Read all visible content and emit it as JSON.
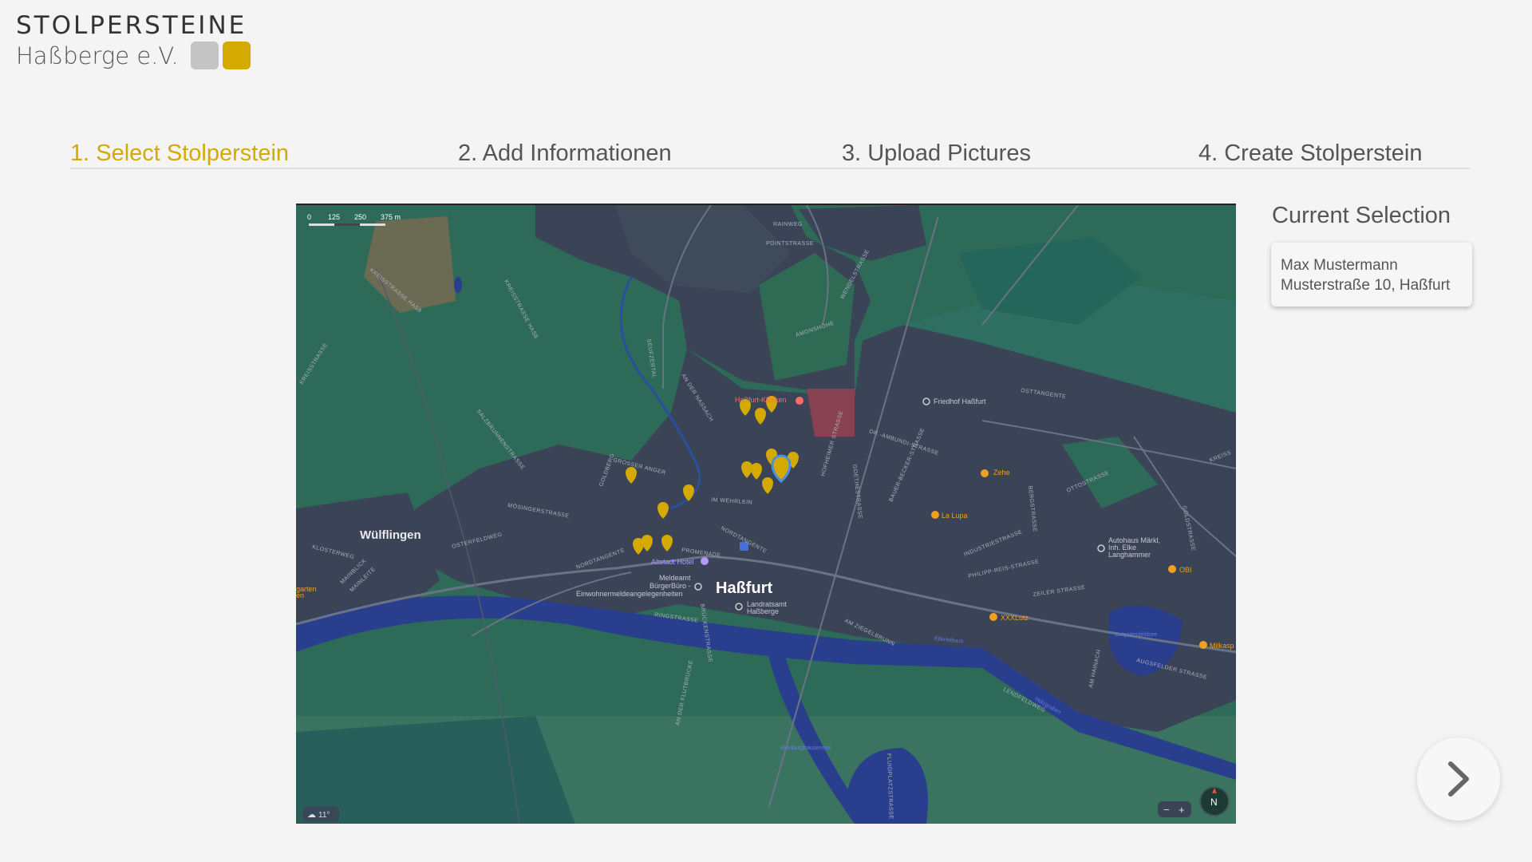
{
  "logo": {
    "title": "STOLPERSTEINE",
    "subtitle": "Haßberge e.V.",
    "colors": [
      "#c4c4c4",
      "#d4aa00"
    ]
  },
  "steps": [
    {
      "label": "1. Select Stolperstein",
      "active": true
    },
    {
      "label": "2. Add Informationen",
      "active": false
    },
    {
      "label": "3. Upload Pictures",
      "active": false
    },
    {
      "label": "4. Create Stolperstein",
      "active": false
    }
  ],
  "accent_color": "#d4aa00",
  "map": {
    "scale_labels": [
      "0",
      "125",
      "250",
      "375 m"
    ],
    "weather": "11°",
    "compass": "N",
    "zoom_out": "−",
    "zoom_in": "+",
    "places": {
      "hassfurt": "Haßfurt",
      "wuelflingen": "Wülflingen",
      "kliniken": "Haßfurt-Kliniken",
      "friedhof": "Friedhof Haßfurt",
      "zehe": "Zehe",
      "la_lupa": "La Lupa",
      "altstadt_hotel": "Altstadt Hotel",
      "meldeamt_1": "Meldeamt",
      "meldeamt_2": "BürgerBüro -",
      "meldeamt_3": "Einwohnermeldeangelegenheiten",
      "landratsamt_1": "Landratsamt",
      "landratsamt_2": "Haßberge",
      "autohaus_1": "Autohaus Märkl,",
      "autohaus_2": "Inh. Elke",
      "autohaus_3": "Langhammer",
      "obi": "OBI",
      "xxxlutz": "XXXLutz",
      "milka": "Milkasp",
      "garten_1": "garten",
      "garten_2": "en"
    },
    "streets": {
      "rainweg": "RAINWEG",
      "pointstrasse": "POINTSTRASSE",
      "wendelstrasse": "WENDELSTRASSE",
      "amonshohe": "AMONSHÖHE",
      "osttangente": "OSTTANGENTE",
      "drambundi": "DR.-AMBUNDI-STRASSE",
      "hofheimer": "HOFHEIMER STRASSE",
      "ottostrasse": "OTTOSTRASSE",
      "kreisstrasse_top": "KREISSTRASSE HAS8",
      "kreisstrasse_has": "KREISSTRASSE HAS8",
      "kreisstrasse_left": "KREISSTRASSE",
      "kreisstrasse_right": "KREISS",
      "salzbrunnen": "SALZBRUNNENSTRASSE",
      "seufzertal": "SEUFZERTAL",
      "an_der_nassach": "AN DER NASSACH",
      "grosser_anger": "GROSSER ANGER",
      "goldberg": "GOLDBERG",
      "im_wehrlein": "IM WEHRLEIN",
      "mosinger": "MÖSINGERSTRASSE",
      "osterfeldweg": "OSTERFELDWEG",
      "klosterweg": "KLOSTERWEG",
      "mainblick": "MAINBLICK",
      "mainleite": "MAINLEITE",
      "nordtangente_1": "NORDTANGENTE",
      "nordtangente_2": "NORDTANGENTE",
      "promenade": "PROMENADE",
      "ringstrasse": "RINGSTRASSE",
      "brueckenstrasse": "BRÜCKENSTRASSE",
      "an_der_flutbruecke": "AN DER FLUTBRÜCKE",
      "goethestrasse": "GOETHESTRASSE",
      "bauer_becker": "BAUER-BECKER-STRASSE",
      "bergstrasse": "BERGSTRASSE",
      "industriestrasse": "INDUSTRIESTRASSE",
      "philipp_reis": "PHILIPP-REIS-STRASSE",
      "zeiler": "ZEILER STRASSE",
      "am_ziegelbrunn": "AM ZIEGELBRUNN",
      "goldstrasse": "GOLDSTRASSE",
      "am_hainach": "AM HAINACH",
      "augsfelder": "AUGSFELDER STRASSE",
      "lendfeldweg": "LENDFELDWEG",
      "fluidplatz": "FLUIDPLATZSTRASSE",
      "see_1": "Ostgartenfeldsee",
      "see_2": "Mainburghausensee",
      "bach_1": "Ellertelbach",
      "bach_2": "Holzgraben"
    }
  },
  "current_selection": {
    "title": "Current Selection",
    "name": "Max Mustermann",
    "address": "Musterstraße 10, Haßfurt"
  },
  "next_button": {
    "icon": "chevron-right-icon"
  }
}
